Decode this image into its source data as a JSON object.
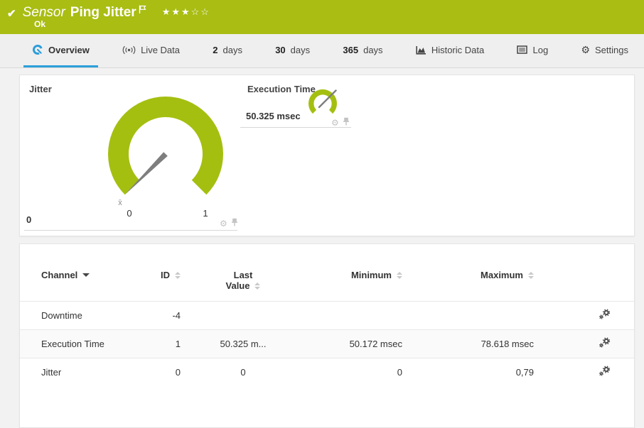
{
  "header": {
    "check": "✔",
    "kind_label": "Sensor",
    "sensor_name": "Ping Jitter",
    "stars": "★★★☆☆",
    "status": "Ok",
    "status_color": "#a9bd13"
  },
  "tabs": [
    {
      "label": "Overview"
    },
    {
      "label": "Live Data"
    },
    {
      "num": "2",
      "label": "days"
    },
    {
      "num": "30",
      "label": "days"
    },
    {
      "num": "365",
      "label": "days"
    },
    {
      "label": "Historic Data"
    },
    {
      "label": "Log"
    },
    {
      "label": "Settings"
    }
  ],
  "gauges": {
    "accent_color": "#a5bf10",
    "jitter": {
      "title": "Jitter",
      "value": "0",
      "scale_min": "0",
      "scale_max": "1",
      "avg_marker": "x̄"
    },
    "execution_time": {
      "title": "Execution Time",
      "value": "50.325 msec"
    }
  },
  "table": {
    "headers": {
      "channel": "Channel",
      "id": "ID",
      "last_line1": "Last",
      "last_line2": "Value",
      "minimum": "Minimum",
      "maximum": "Maximum"
    },
    "rows": [
      {
        "channel": "Downtime",
        "id": "-4",
        "last": "",
        "min": "",
        "max": ""
      },
      {
        "channel": "Execution Time",
        "id": "1",
        "last": "50.325 m...",
        "min": "50.172 msec",
        "max": "78.618 msec"
      },
      {
        "channel": "Jitter",
        "id": "0",
        "last": "0",
        "min": "0",
        "max": "0,79"
      }
    ]
  }
}
